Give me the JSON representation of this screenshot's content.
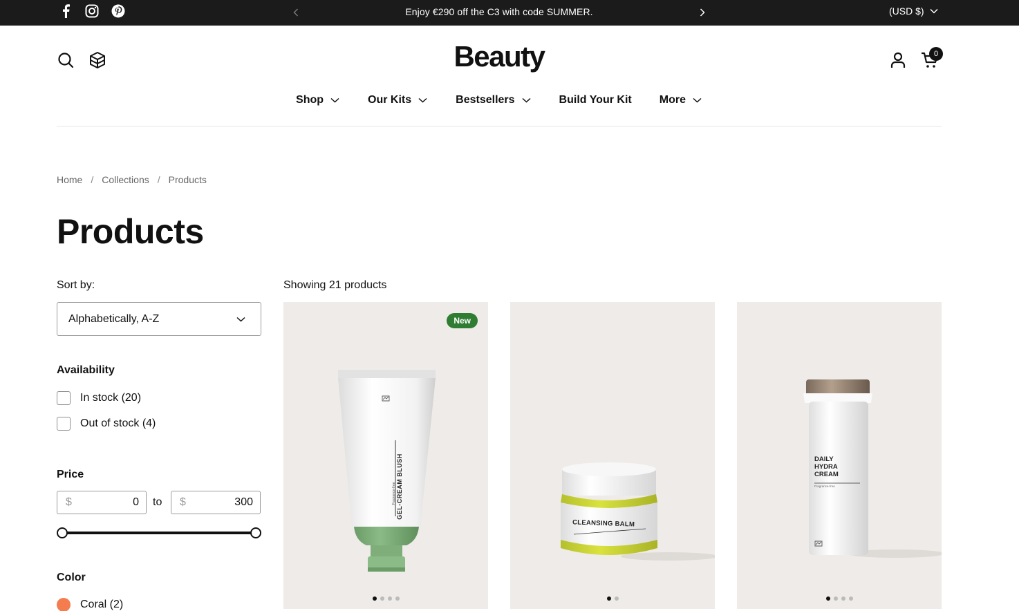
{
  "announcement": {
    "text": "Enjoy €290 off the C3 with code SUMMER.",
    "currency": "(USD $)",
    "social_icons": [
      "facebook-icon",
      "instagram-icon",
      "pinterest-icon"
    ]
  },
  "header": {
    "logo": "Beauty",
    "cart_count": "0",
    "nav": [
      {
        "label": "Shop",
        "has_dropdown": true
      },
      {
        "label": "Our Kits",
        "has_dropdown": true
      },
      {
        "label": "Bestsellers",
        "has_dropdown": true
      },
      {
        "label": "Build Your Kit",
        "has_dropdown": false
      },
      {
        "label": "More",
        "has_dropdown": true
      }
    ]
  },
  "breadcrumb": [
    "Home",
    "Collections",
    "Products"
  ],
  "breadcrumb_separator": "/",
  "page_title": "Products",
  "sidebar": {
    "sort_label": "Sort by:",
    "sort_value": "Alphabetically, A-Z",
    "availability": {
      "heading": "Availability",
      "options": [
        "In stock (20)",
        "Out of stock (4)"
      ]
    },
    "price": {
      "heading": "Price",
      "currency_symbol": "$",
      "min": "0",
      "max": "300",
      "to_label": "to"
    },
    "color": {
      "heading": "Color",
      "options": [
        {
          "label": "Coral (2)",
          "swatch": "#f47c4e"
        }
      ]
    }
  },
  "products": {
    "showing": "Showing 21 products",
    "cards": [
      {
        "badge": "New",
        "image": "gel-cream-blush-tube",
        "product_text": "GEL-CREAM BLUSH",
        "product_subtext": "Fragrance-free",
        "dots": 4,
        "active_dot": 0
      },
      {
        "badge": "",
        "image": "cleansing-balm-jar",
        "product_text": "CLEANSING BALM",
        "dots": 2,
        "active_dot": 0
      },
      {
        "badge": "",
        "image": "daily-hydra-cream-bottle",
        "product_text": "DAILY HYDRA CREAM",
        "product_subtext": "Fragrance-free",
        "dots": 4,
        "active_dot": 0
      }
    ]
  },
  "colors": {
    "announcement_bg": "#1b1b1b",
    "card_bg": "#eeebe8",
    "badge_bg": "#2e7d32",
    "tube_green": "#7fae7a",
    "balm_yellow": "#c9d43a"
  }
}
